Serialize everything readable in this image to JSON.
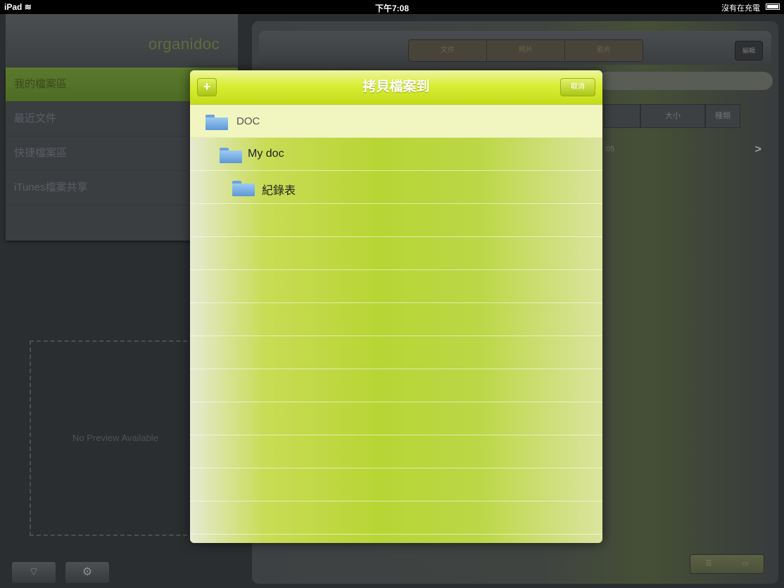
{
  "status_bar": {
    "device": "iPad",
    "wifi_icon": "wifi-icon",
    "time": "下午7:08",
    "charge": "沒有在充電"
  },
  "sidebar": {
    "logo": "organidoc",
    "items": [
      {
        "label": "我的檔案區"
      },
      {
        "label": "最近文件"
      },
      {
        "label": "快捷檔案區"
      },
      {
        "label": "iTunes檔案共享"
      }
    ],
    "preview_text": "No Preview Available"
  },
  "main": {
    "segments": [
      "文件",
      "照片",
      "影片"
    ],
    "edit_label": "編輯",
    "columns": [
      "大小",
      "種類"
    ],
    "row_date": ":05"
  },
  "popover": {
    "title": "拷貝檔案到",
    "add_label": "+",
    "cancel_label": "取消",
    "folders": [
      {
        "label": "DOC"
      },
      {
        "label": "My doc"
      },
      {
        "label": "紀錄表"
      }
    ]
  },
  "colors": {
    "accent_green": "#b8d535",
    "sidebar_active": "#5c7a2e",
    "folder_blue": "#5d97d4"
  }
}
